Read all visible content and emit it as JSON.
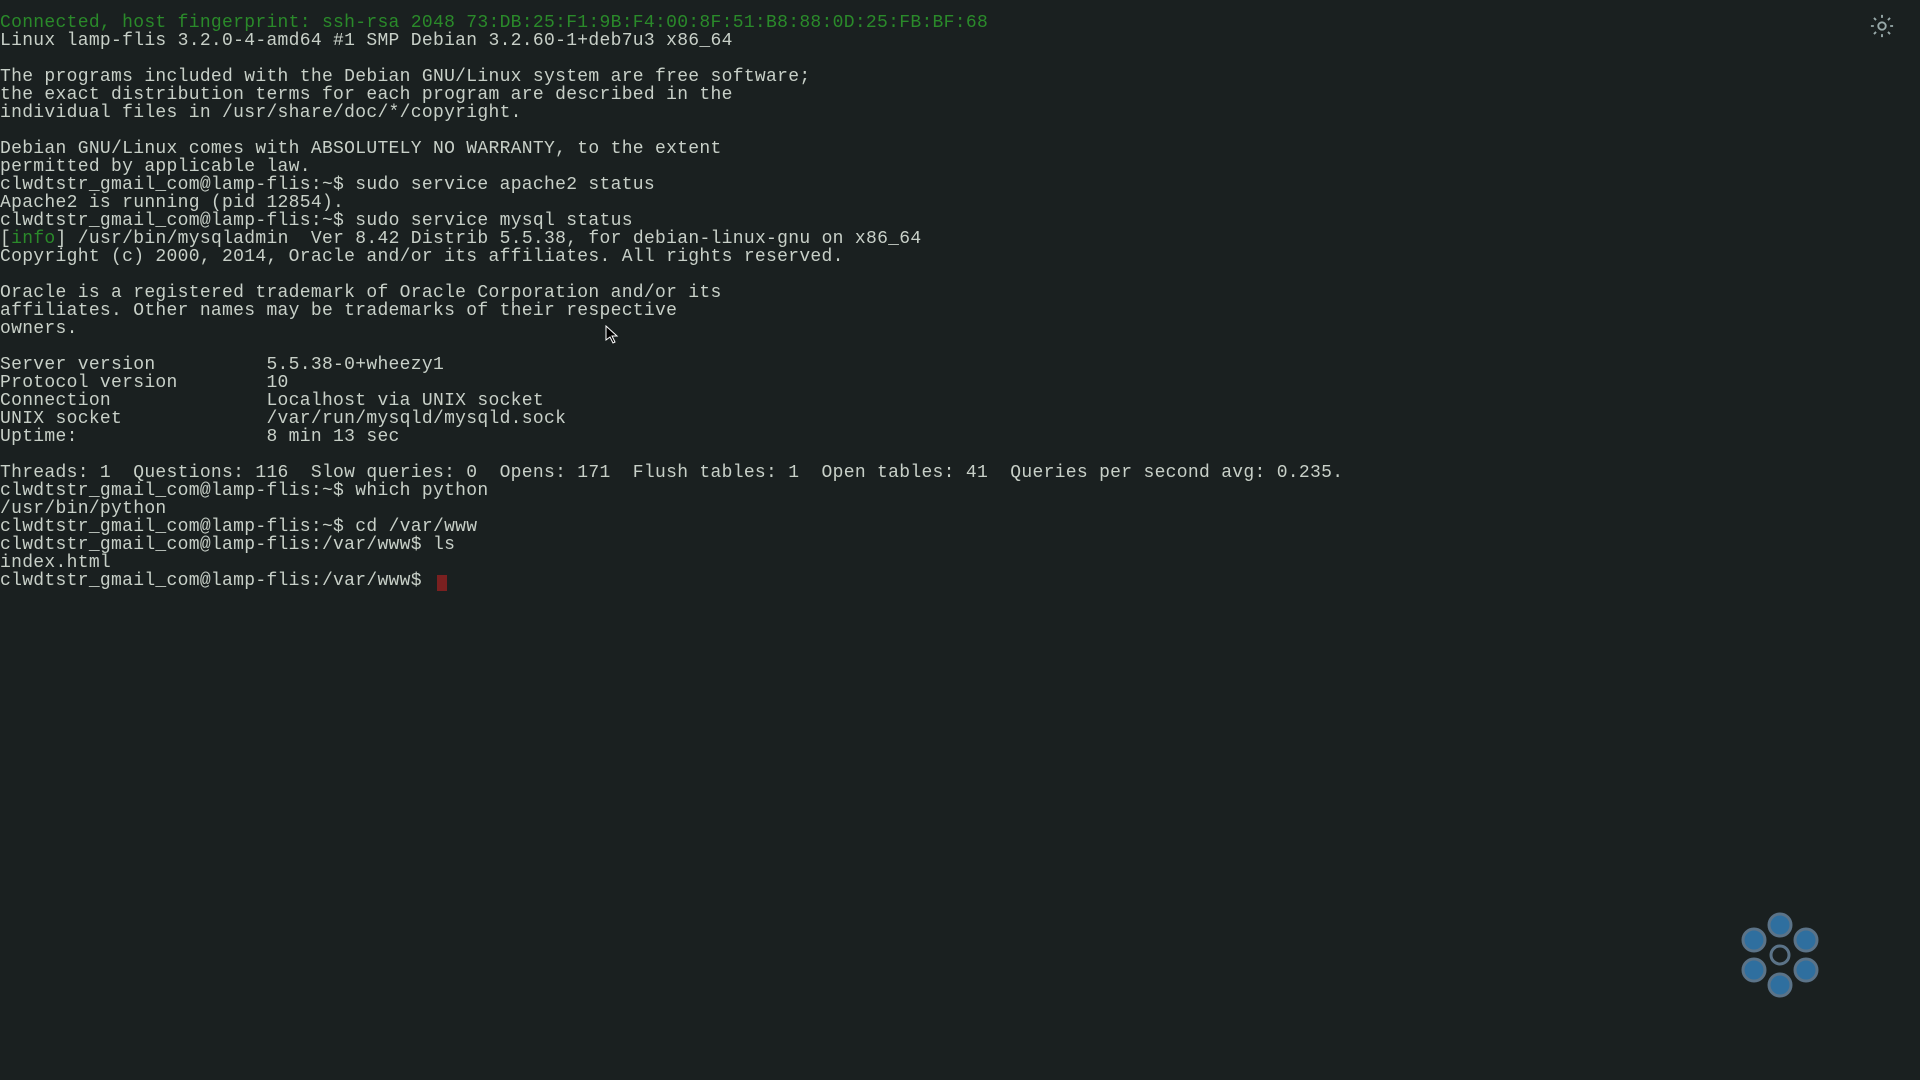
{
  "terminal": {
    "conn_line": "Connected, host fingerprint: ssh-rsa 2048 73:DB:25:F1:9B:F4:00:8F:51:B8:88:0D:25:FB:BF:68",
    "uname_line": "Linux lamp-flis 3.2.0-4-amd64 #1 SMP Debian 3.2.60-1+deb7u3 x86_64",
    "motd1": "The programs included with the Debian GNU/Linux system are free software;",
    "motd2": "the exact distribution terms for each program are described in the",
    "motd3": "individual files in /usr/share/doc/*/copyright.",
    "motd4": "Debian GNU/Linux comes with ABSOLUTELY NO WARRANTY, to the extent",
    "motd5": "permitted by applicable law.",
    "prompt_home": "clwdtstr_gmail_com@lamp-flis:~$ ",
    "cmd_apache": "sudo service apache2 status",
    "apache_out": "Apache2 is running (pid 12854).",
    "cmd_mysql": "sudo service mysql status",
    "info_tag_open": "[",
    "info_tag_text": "info",
    "info_tag_close": "] ",
    "mysql_ver": "/usr/bin/mysqladmin  Ver 8.42 Distrib 5.5.38, for debian-linux-gnu on x86_64",
    "mysql_copy": "Copyright (c) 2000, 2014, Oracle and/or its affiliates. All rights reserved.",
    "oracle1": "Oracle is a registered trademark of Oracle Corporation and/or its",
    "oracle2": "affiliates. Other names may be trademarks of their respective",
    "oracle3": "owners.",
    "kv_server": "Server version          5.5.38-0+wheezy1",
    "kv_proto": "Protocol version        10",
    "kv_conn": "Connection              Localhost via UNIX socket",
    "kv_sock": "UNIX socket             /var/run/mysqld/mysqld.sock",
    "kv_uptime": "Uptime:                 8 min 13 sec",
    "stats": "Threads: 1  Questions: 116  Slow queries: 0  Opens: 171  Flush tables: 1  Open tables: 41  Queries per second avg: 0.235.",
    "cmd_which": "which python",
    "which_out": "/usr/bin/python",
    "cmd_cd": "cd /var/www",
    "prompt_www": "clwdtstr_gmail_com@lamp-flis:/var/www$ ",
    "cmd_ls": "ls",
    "ls_out": "index.html"
  },
  "icons": {
    "gear": "settings-gear",
    "brand": "cloud-brand-logo"
  }
}
